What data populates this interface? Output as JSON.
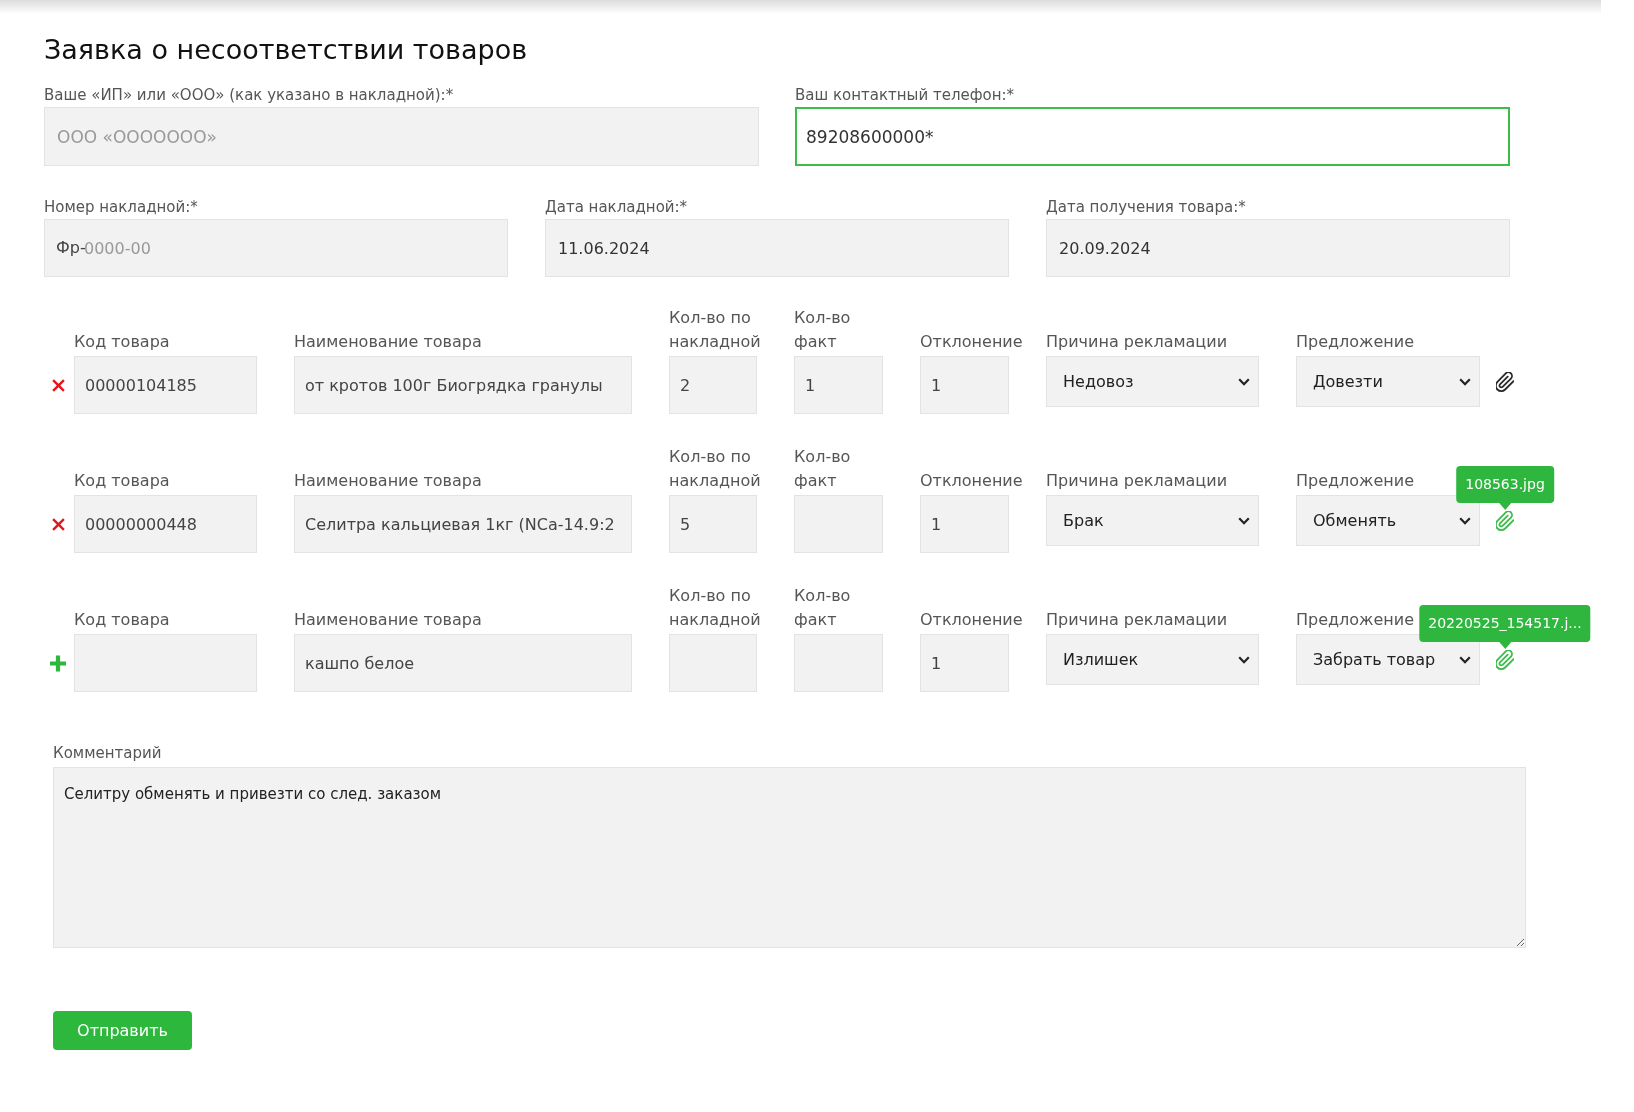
{
  "title": "Заявка о несоответствии товаров",
  "contact_fields": [
    {
      "label": "Ваше «ИП» или «ООО» (как указано в накладной):*",
      "placeholder": "ООО «ООООООО»",
      "focused": false
    },
    {
      "label": "Ваш контактный телефон:*",
      "value": "89208600000*",
      "focused": true
    }
  ],
  "invoice_fields": [
    {
      "label": "Номер накладной:*",
      "prefix": "Фр-",
      "placeholder": "0000-00",
      "focused": false
    },
    {
      "label": "Дата накладной:*",
      "value": "11.06.2024",
      "focused": false
    },
    {
      "label": "Дата получения товара:*",
      "value": "20.09.2024",
      "focused": false
    }
  ],
  "items": [
    {
      "kind": "remove",
      "attached": false,
      "fields": [
        {
          "kind": "input",
          "label": "Код товара",
          "value": "00000104185"
        },
        {
          "kind": "input",
          "label": "Наименование товара",
          "value": "от кротов 100г Биогрядка гранулы"
        },
        {
          "kind": "input",
          "label": "Кол-во по накладной",
          "value": "2"
        },
        {
          "kind": "input",
          "label": "Кол-во факт",
          "value": "1"
        },
        {
          "kind": "input",
          "label": "Отклонение",
          "value": "1"
        },
        {
          "kind": "select",
          "label": "Причина рекламации",
          "value": "Недовоз"
        },
        {
          "kind": "select",
          "label": "Предложение",
          "value": "Довезти"
        }
      ]
    },
    {
      "kind": "remove",
      "attached": true,
      "attachment_name": "108563.jpg",
      "fields": [
        {
          "kind": "input",
          "label": "Код товара",
          "value": "00000000448"
        },
        {
          "kind": "input",
          "label": "Наименование товара",
          "value": "Селитра кальциевая 1кг (NCa-14.9:2"
        },
        {
          "kind": "input",
          "label": "Кол-во по накладной",
          "value": "5"
        },
        {
          "kind": "input",
          "label": "Кол-во факт"
        },
        {
          "kind": "input",
          "label": "Отклонение",
          "value": "1"
        },
        {
          "kind": "select",
          "label": "Причина рекламации",
          "value": "Брак"
        },
        {
          "kind": "select",
          "label": "Предложение",
          "value": "Обменять"
        }
      ]
    },
    {
      "kind": "add",
      "attached": true,
      "attachment_name": "20220525_154517.j...",
      "fields": [
        {
          "kind": "input",
          "label": "Код товара"
        },
        {
          "kind": "input",
          "label": "Наименование товара",
          "value": "кашпо белое"
        },
        {
          "kind": "input",
          "label": "Кол-во по накладной"
        },
        {
          "kind": "input",
          "label": "Кол-во факт"
        },
        {
          "kind": "input",
          "label": "Отклонение",
          "value": "1"
        },
        {
          "kind": "select",
          "label": "Причина рекламации",
          "value": "Излишек"
        },
        {
          "kind": "select",
          "label": "Предложение",
          "value": "Забрать товар"
        }
      ]
    }
  ],
  "comment": {
    "label": "Комментарий",
    "value": "Селитру обменять и привезти со след. заказом"
  },
  "submit_button": "Отправить"
}
